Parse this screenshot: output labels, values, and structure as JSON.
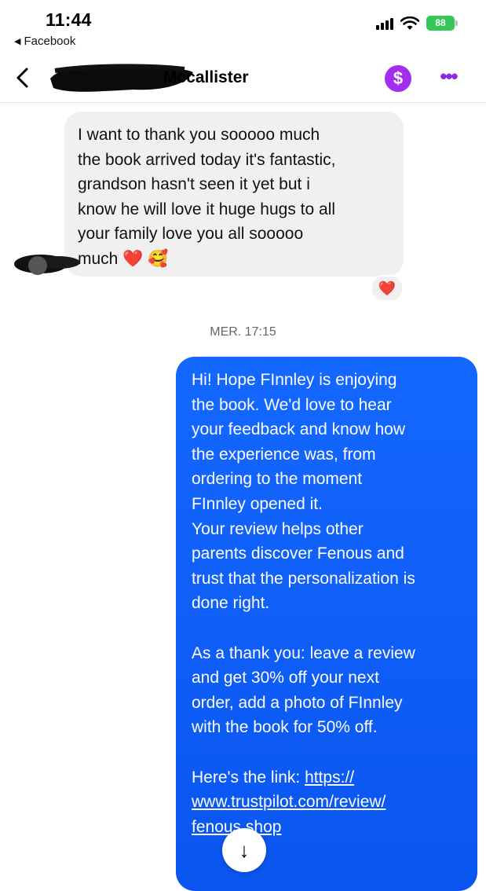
{
  "status_bar": {
    "time": "11:44",
    "back_app": "Facebook",
    "battery": "88"
  },
  "header": {
    "contact_name": "Mccallister",
    "pay_symbol": "$",
    "more_symbol": "•••"
  },
  "thread": {
    "received_message": {
      "text": "I want to thank you sooooo much\nthe book arrived today it's fantastic,\ngrandson hasn't seen it yet but i\nknow he will love it huge hugs to all\nyour family love you all sooooo\nmuch",
      "emojis": "❤️ 🥰",
      "reaction": "❤️"
    },
    "timestamp": "MER. 17:15",
    "sent_message": {
      "text": "Hi! Hope FInnley is enjoying\nthe book. We'd love to hear\nyour feedback and know how\nthe experience was, from\nordering to the moment\nFInnley opened it.\nYour review helps other\nparents discover Fenous and\ntrust that the personalization is\ndone right.\n\nAs a thank you: leave a review\nand get 30% off your next\norder, add a photo of FInnley\nwith the book for 50% off.\n\nHere's the link: ",
      "link_text": "https://\nwww.trustpilot.com/review/\nfenous.shop"
    }
  },
  "scroll_button": "↓",
  "colors": {
    "sent_bubble": "#0a55f0",
    "received_bubble": "#f0f0f0",
    "accent_purple": "#a42ef0",
    "battery_green": "#34c759"
  }
}
